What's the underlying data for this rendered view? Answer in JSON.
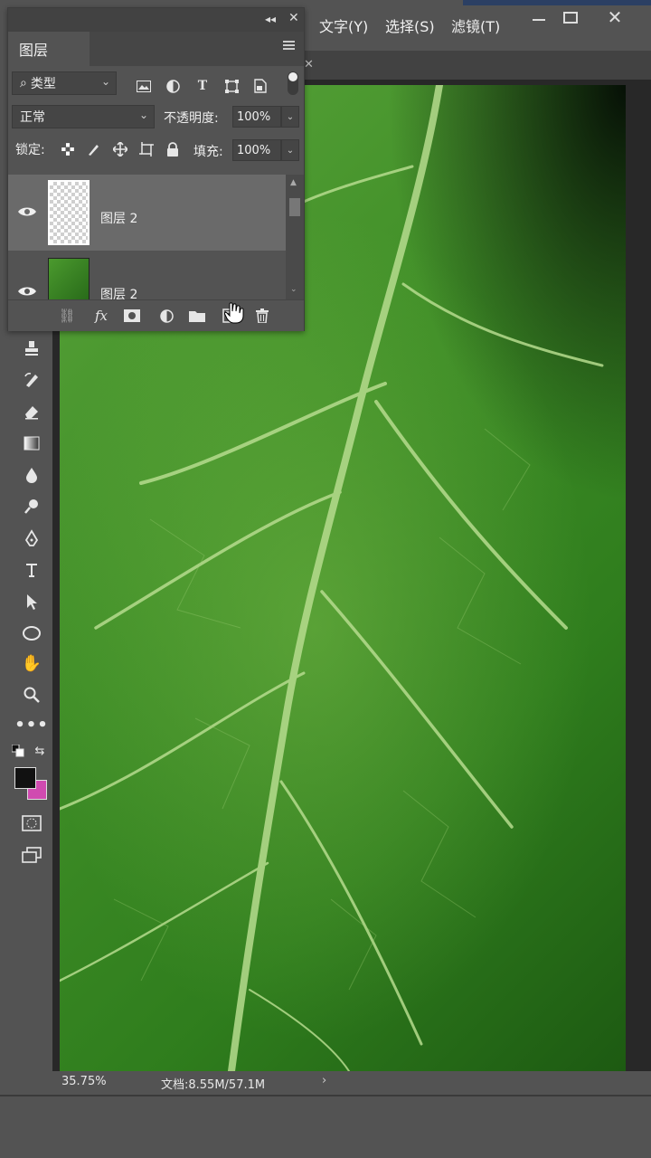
{
  "menu": {
    "items": [
      "文字(Y)",
      "选择(S)",
      "滤镜(T)"
    ]
  },
  "layers_panel": {
    "tab_label": "图层",
    "filter": {
      "kind_label": "类型"
    },
    "blend_mode": "正常",
    "opacity_label": "不透明度:",
    "opacity_value": "100%",
    "lock_label": "锁定:",
    "fill_label": "填充:",
    "fill_value": "100%",
    "layers": [
      {
        "name": "图层 2",
        "selected": true,
        "visible": true,
        "thumb": "transparent"
      },
      {
        "name": "图层 2",
        "selected": false,
        "visible": true,
        "thumb": "leaf"
      }
    ]
  },
  "status": {
    "zoom": "35.75%",
    "doc_info": "文档:8.55M/57.1M"
  },
  "colors": {
    "foreground": "#111111",
    "background": "#d04ab0"
  },
  "icons": {
    "filter_row": [
      "image-filter-icon",
      "adjustment-filter-icon",
      "type-filter-icon",
      "shape-filter-icon",
      "smart-object-filter-icon"
    ],
    "lock_row": [
      "lock-transparent-pixels-icon",
      "lock-image-pixels-icon",
      "lock-position-icon",
      "lock-artboard-icon",
      "lock-all-icon"
    ],
    "bottom_row": [
      "link-layers-icon",
      "fx-icon",
      "add-mask-icon",
      "adjustment-layer-icon",
      "new-group-icon",
      "new-layer-icon",
      "delete-layer-icon"
    ],
    "tools": [
      "stamp-tool-icon",
      "history-brush-icon",
      "eraser-icon",
      "gradient-icon",
      "blur-icon",
      "dodge-icon",
      "pen-icon",
      "type-tool-icon",
      "path-select-icon",
      "ellipse-icon",
      "hand-icon",
      "zoom-icon",
      "more-tools-icon"
    ]
  }
}
